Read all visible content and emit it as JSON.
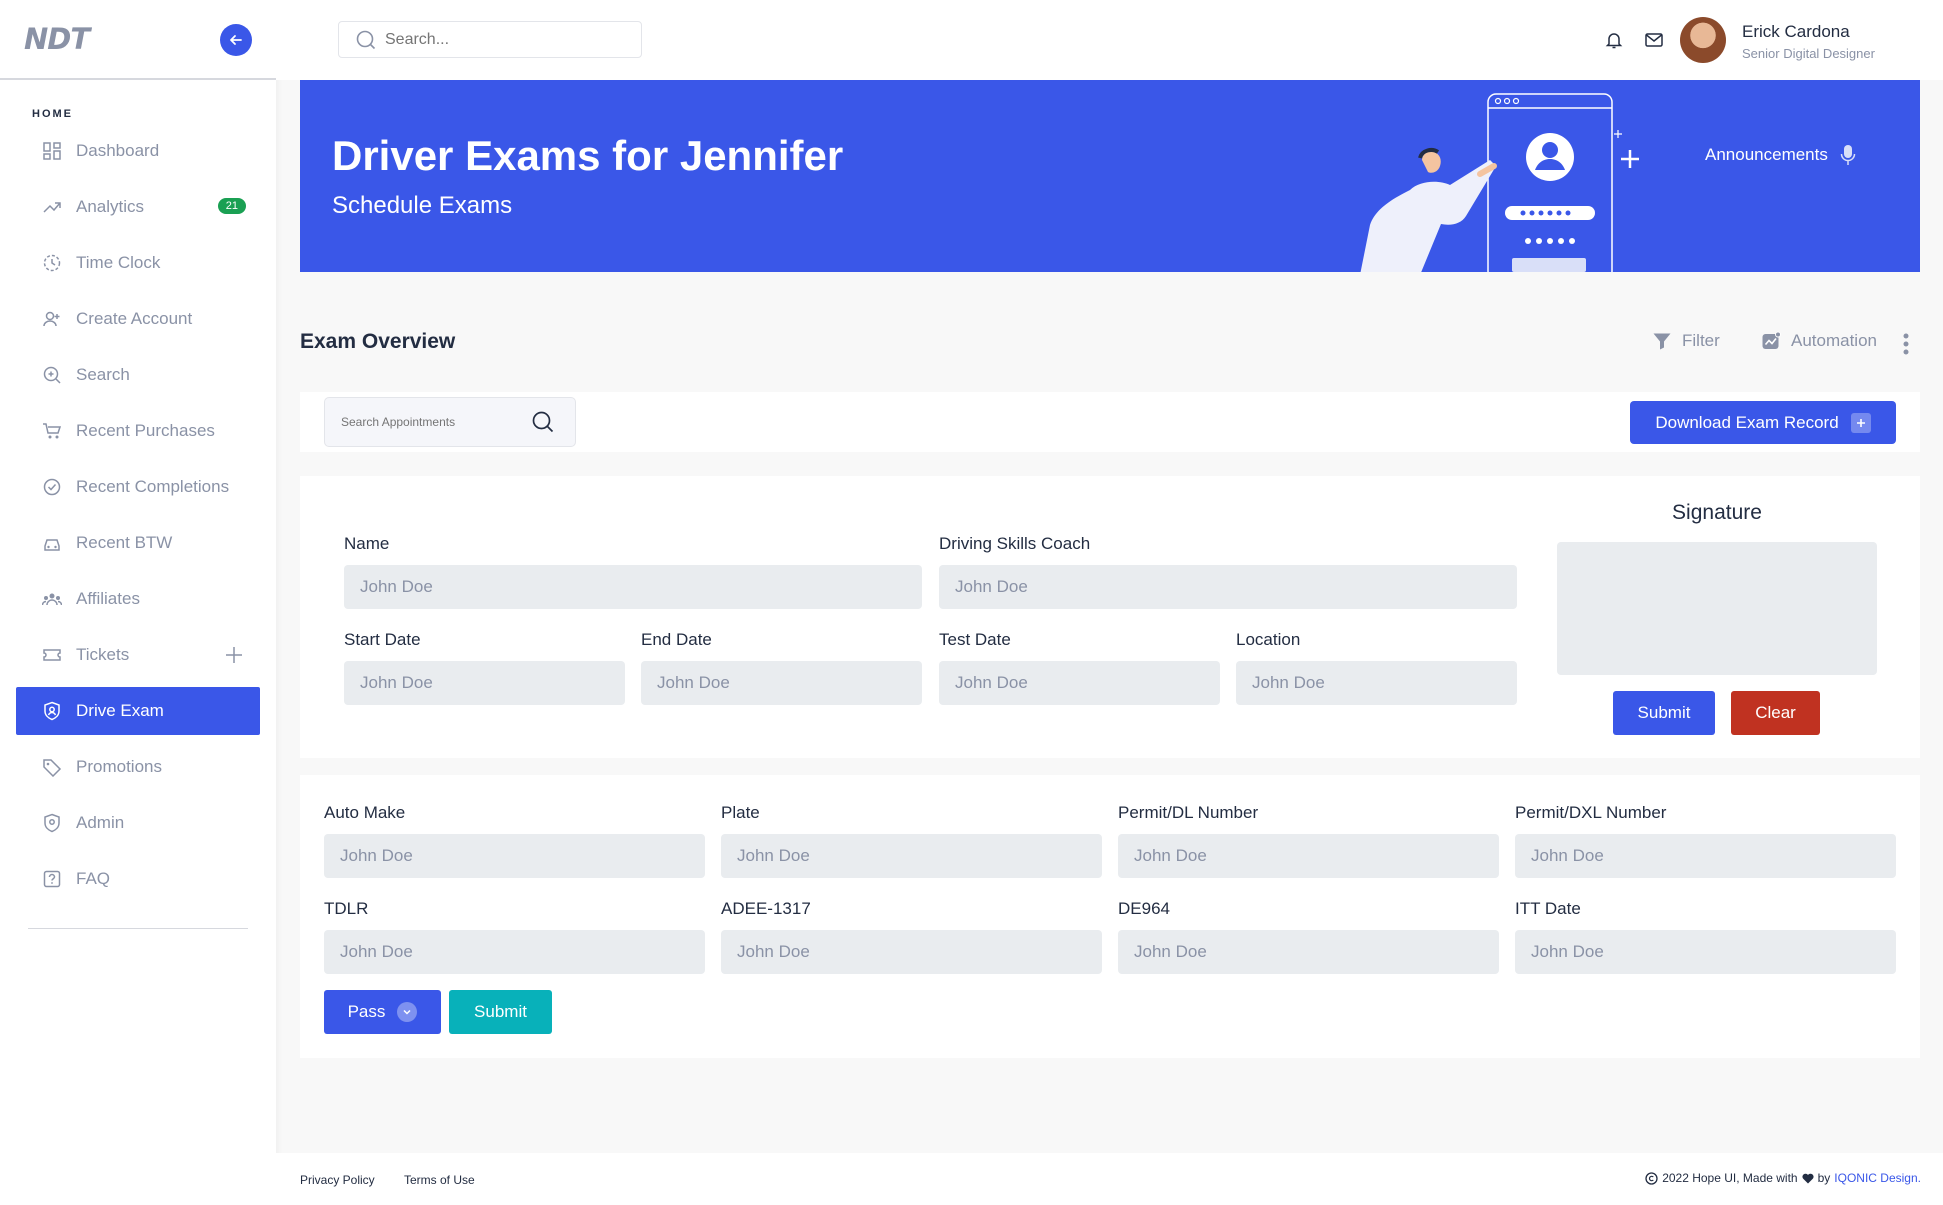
{
  "brand": {
    "logo": "NDT"
  },
  "sidebar": {
    "section_label": "HOME",
    "items": [
      {
        "label": "Dashboard",
        "icon": "grid-icon"
      },
      {
        "label": "Analytics",
        "icon": "trend-icon",
        "badge": "21"
      },
      {
        "label": "Time Clock",
        "icon": "clock-icon"
      },
      {
        "label": "Create Account",
        "icon": "add-user-icon"
      },
      {
        "label": "Search",
        "icon": "search-icon"
      },
      {
        "label": "Recent Purchases",
        "icon": "cart-icon"
      },
      {
        "label": "Recent Completions",
        "icon": "check-badge-icon"
      },
      {
        "label": "Recent BTW",
        "icon": "car-icon"
      },
      {
        "label": "Affiliates",
        "icon": "users-icon"
      },
      {
        "label": "Tickets",
        "icon": "ticket-icon"
      },
      {
        "label": "Drive Exam",
        "icon": "shield-user-icon",
        "active": true
      },
      {
        "label": "Promotions",
        "icon": "tag-icon"
      },
      {
        "label": "Admin",
        "icon": "shield-icon"
      },
      {
        "label": "FAQ",
        "icon": "question-icon"
      }
    ]
  },
  "header": {
    "search_placeholder": "Search...",
    "user_name": "Erick Cardona",
    "user_role": "Senior Digital Designer"
  },
  "banner": {
    "title": "Driver Exams for Jennifer",
    "subtitle": "Schedule Exams",
    "announcements": "Announcements"
  },
  "overview": {
    "title": "Exam Overview",
    "filter_label": "Filter",
    "automation_label": "Automation"
  },
  "toolbar": {
    "appointments_placeholder": "Search Appointments",
    "download_label": "Download Exam Record"
  },
  "exam_form": {
    "name_label": "Name",
    "coach_label": "Driving Skills Coach",
    "start_label": "Start Date",
    "end_label": "End Date",
    "test_label": "Test Date",
    "location_label": "Location",
    "placeholder": "John Doe"
  },
  "signature": {
    "title": "Signature",
    "submit_label": "Submit",
    "clear_label": "Clear"
  },
  "vehicle_form": {
    "auto_make_label": "Auto Make",
    "plate_label": "Plate",
    "permit_dl_label": "Permit/DL Number",
    "permit_dxl_label": "Permit/DXL Number",
    "tdlr_label": "TDLR",
    "adee_label": "ADEE-1317",
    "de964_label": "DE964",
    "itt_label": "ITT Date",
    "placeholder": "John Doe",
    "pass_label": "Pass",
    "submit_label": "Submit"
  },
  "footer": {
    "privacy": "Privacy Policy",
    "terms": "Terms of Use",
    "copyright": "2022 Hope UI, Made with",
    "by": "by",
    "company": "IQONIC Design."
  },
  "colors": {
    "primary": "#3a57e8",
    "success": "#1aa053",
    "danger": "#c03221",
    "info": "#08b1ba"
  }
}
